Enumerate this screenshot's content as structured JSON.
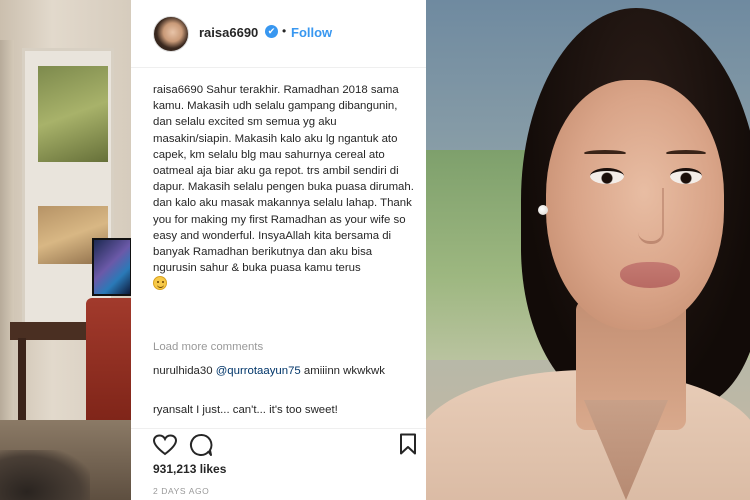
{
  "post": {
    "username": "raisa6690",
    "verified_mark": "✔",
    "separator": "•",
    "follow_label": "Follow"
  },
  "caption": {
    "username": "raisa6690",
    "text": "Sahur terakhir. Ramadhan 2018 sama kamu. Makasih udh selalu gampang dibangunin, dan selalu excited sm semua yg aku masakin/siapin. Makasih kalo aku lg ngantuk ato capek, km selalu blg mau sahurnya cereal ato oatmeal aja biar aku ga repot. trs ambil sendiri di dapur. Makasih selalu pengen buka puasa dirumah. dan kalo aku masak makannya selalu lahap. Thank you for making my first Ramadhan as your wife so easy and wonderful. InsyaAllah kita bersama di banyak Ramadhan berikutnya dan aku bisa ngurusin sahur & buka puasa kamu terus",
    "emoji": "smiling-face-emoji"
  },
  "comments": {
    "load_more": "Load more comments",
    "items": [
      {
        "username": "nurulhida30",
        "mention": "@qurrotaayun75",
        "text": "amiiinn wkwkwk"
      },
      {
        "username": "ryansalt",
        "mention": "",
        "text": "I just... can't... it's too sweet!"
      }
    ]
  },
  "stats": {
    "likes": "931,213 likes",
    "timestamp": "2 DAYS AGO"
  },
  "icons": {
    "like": "heart-icon",
    "comment": "comment-icon",
    "save": "bookmark-icon"
  },
  "colors": {
    "link_blue": "#3897f0",
    "text": "#262626",
    "muted": "#999999",
    "mention": "#003569"
  }
}
